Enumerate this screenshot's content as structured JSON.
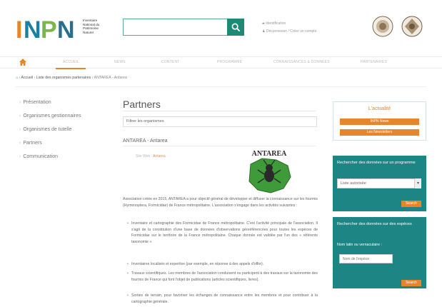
{
  "header": {
    "logo_word": "INPN",
    "logo_text": [
      "Inventaire",
      "National du",
      "Patrimoine",
      "Naturel"
    ],
    "search_placeholder": "",
    "account_links": [
      "Identification",
      "Déconnexion / Créer un compte"
    ]
  },
  "nav": {
    "items": [
      "ACCUEIL",
      "NEWS",
      "CONTENT",
      "PROGRAMME",
      "CONNAISSANCES & DONNÉES",
      "PARTENAIRES"
    ]
  },
  "breadcrumb": {
    "items": [
      "Accueil",
      "Liste des organismes partenaires",
      "ANTAREA - Antarea"
    ]
  },
  "sidebar": {
    "items": [
      "Présentation",
      "Organismes gestionnaires",
      "Organismes de tutelle",
      "Partners",
      "Communication"
    ]
  },
  "main": {
    "title": "Partners",
    "filter_value": "Filtrer les organismes",
    "org_name": "ANTAREA - Antarea",
    "website_prefix": "Site Web : ",
    "website_link": "Antarea",
    "logo_caption": "ANTAREA",
    "intro": "Association créée en 2015, ANTAREA a pour objectif général de développer et diffuser la connaissance sur les fourmis (Hymenoptera, Formicidae) de France métropolitaine. L'association s'engage dans les activités suivantes :",
    "bullets": [
      "Inventaire et cartographie des Formicidae de France métropolitaine. C'est l'activité principale de l'association. Il s'agit de la constitution d'une base de données d'observations géoréférencées pour toutes les espèces de Formicidae sur le territoire de la France métropolitaine. Chaque donnée est validée par l'un des « référents taxonomie ».",
      "Inventaires localisés et expertise (par exemple, en réponse à des appels d'offre).",
      "Travaux scientifiques. Les membres de l'association conduisent ou participent à des travaux sur la taxonomie des fourmis de France qui font l'objet de publications (articles scientifiques, livres).",
      "Sorties de terrain, pour favoriser les échanges de connaissance entre les membres et pour contribuer à la cartographie générale."
    ]
  },
  "right": {
    "news_title": "L'actualité",
    "news_buttons": [
      "INPN News",
      "Les Newsletters"
    ],
    "box1_label": "Rechercher des données sur un programme",
    "box1_select": "Liste autorisée",
    "box1_button": "Search",
    "box2_label": "Rechercher des données sur des espèces",
    "box2_sublabel": "Nom latin ou vernaculaire :",
    "box2_placeholder": "Nom de l'espèce",
    "box2_button": "Search"
  },
  "colors": {
    "accent": "#e8842a",
    "teal": "#1d8583",
    "search_green": "#1c8a74"
  }
}
